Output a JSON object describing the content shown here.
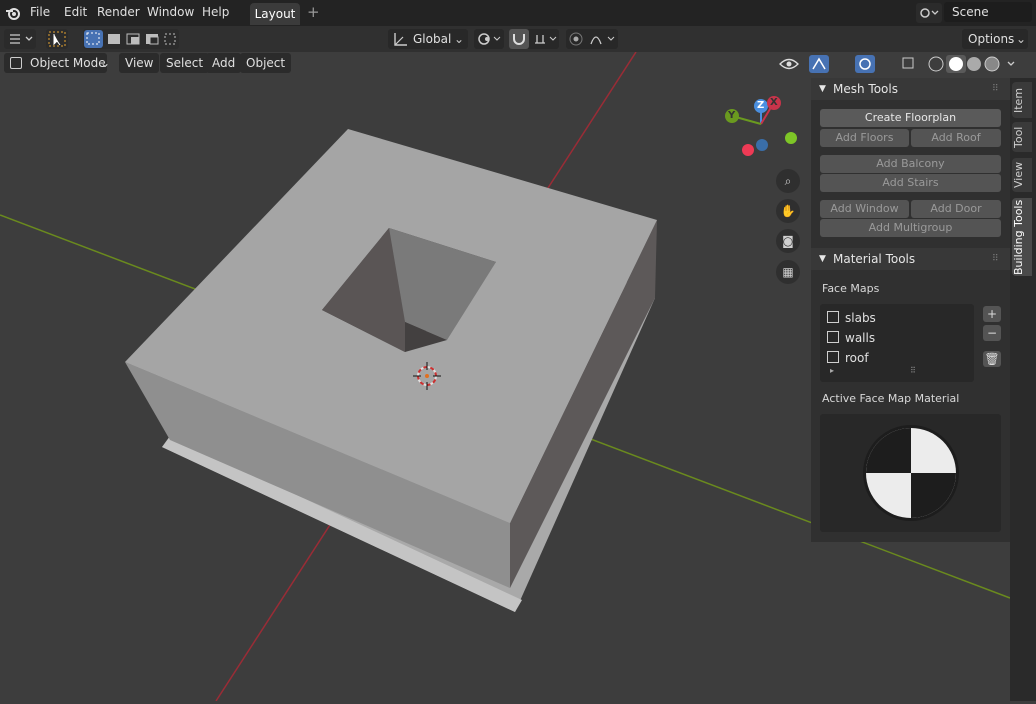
{
  "topbar": {
    "menus": [
      "File",
      "Edit",
      "Render",
      "Window",
      "Help"
    ],
    "workspace_tab": "Layout",
    "add_tab": "+",
    "scene": "Scene"
  },
  "toolbar": {
    "orientation": "Global",
    "options": "Options"
  },
  "header": {
    "mode": "Object Mode",
    "menus": [
      "View",
      "Select",
      "Add",
      "Object"
    ]
  },
  "gizmo": {
    "x": "X",
    "y": "Y",
    "z": "Z"
  },
  "npanel": {
    "mesh_tools_title": "Mesh Tools",
    "create_floorplan": "Create Floorplan",
    "add_floors": "Add Floors",
    "add_roof": "Add Roof",
    "add_balcony": "Add Balcony",
    "add_stairs": "Add Stairs",
    "add_window": "Add Window",
    "add_door": "Add Door",
    "add_multigroup": "Add Multigroup",
    "material_tools_title": "Material Tools",
    "face_maps_label": "Face Maps",
    "face_maps": [
      "slabs",
      "walls",
      "roof"
    ],
    "active_material_label": "Active Face Map Material"
  },
  "sidebar_tabs": [
    "Item",
    "Tool",
    "View",
    "Building Tools"
  ],
  "colors": {
    "accent": "#4772b3",
    "x_axis": "#c8344a",
    "y_axis": "#6a9a1f",
    "z_axis": "#4a8fe0"
  }
}
